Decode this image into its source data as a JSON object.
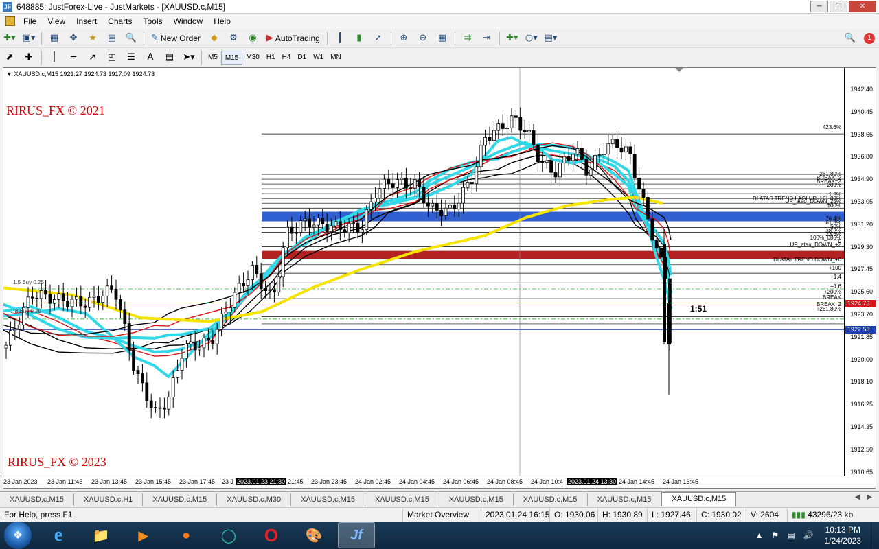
{
  "window": {
    "title": "648885: JustForex-Live - JustMarkets - [XAUUSD.c,M15]",
    "icon_label": "JF"
  },
  "menu": [
    "File",
    "View",
    "Insert",
    "Charts",
    "Tools",
    "Window",
    "Help"
  ],
  "toolbar": {
    "new_order": "New Order",
    "auto_trading": "AutoTrading",
    "timeframes": [
      "M5",
      "M15",
      "M30",
      "H1",
      "H4",
      "D1",
      "W1",
      "MN"
    ],
    "active_timeframe": "M15"
  },
  "chart": {
    "header": "XAUUSD.c,M15  1921.27 1924.73 1917.09 1924.73",
    "watermark_top": "RIRUS_FX © 2021",
    "watermark_bottom": "RIRUS_FX © 2023",
    "countdown": "1:51",
    "price_ticks": [
      "1942.40",
      "1940.45",
      "1938.65",
      "1936.80",
      "1934.90",
      "1933.05",
      "1931.20",
      "1929.30",
      "1927.45",
      "1925.60",
      "1923.70",
      "1921.85",
      "1920.00",
      "1918.10",
      "1916.25",
      "1914.35",
      "1912.50",
      "1910.65"
    ],
    "bid_price": "1924.73",
    "line_price": "1922.53",
    "time_ticks": [
      "23 Jan 2023",
      "23 Jan 11:45",
      "23 Jan 13:45",
      "23 Jan 15:45",
      "23 Jan 17:45",
      "23 J",
      "2023.01.23 21:30",
      "21:45",
      "23 Jan 23:45",
      "24 Jan 02:45",
      "24 Jan 04:45",
      "24 Jan 06:45",
      "24 Jan 08:45",
      "24 Jan 10:4",
      "2023.01.24 13:30",
      "24 Jan 14:45",
      "24 Jan 16:45"
    ],
    "level_labels": [
      "423.6%",
      "261.80%",
      "BREAK_2",
      "BREAK_2",
      "200%",
      "1.8%",
      "DI ATAS TREND LAGI UP_161.80%",
      "UP_atau_DOWN_25%",
      "100%",
      "76.4%",
      "61.8%",
      "50%",
      "38.2%",
      "23.6%",
      "100%_085%",
      "0",
      "UP_atau_DOWN_+2",
      "DI ATAs TREND DOWN_+0",
      "+100",
      "+1.4",
      "+1.6",
      "+200%",
      "BREAK",
      "BREAK_2",
      "+261.80%"
    ],
    "left_labels": [
      "1.5 Buy 0.25",
      "1.8 Buy 0.25"
    ],
    "colors": {
      "blue_zone": "#2f5fd0",
      "red_zone": "#b22222",
      "yellow_ma": "#f5e400",
      "cyan_band": "#31d8e8",
      "red_band": "#e01010"
    }
  },
  "tabs": [
    "XAUUSD.c,M15",
    "XAUUSD.c,H1",
    "XAUUSD.c,M15",
    "XAUUSD.c,M30",
    "XAUUSD.c,M15",
    "XAUUSD.c,M15",
    "XAUUSD.c,M15",
    "XAUUSD.c,M15",
    "XAUUSD.c,M15",
    "XAUUSD.c,M15"
  ],
  "active_tab_index": 9,
  "status": {
    "help": "For Help, press F1",
    "profile": "Market Overview",
    "datetime": "2023.01.24 16:15",
    "open": "O: 1930.06",
    "high": "H: 1930.89",
    "low": "L: 1927.46",
    "close": "C: 1930.02",
    "volume": "V: 2604",
    "traffic": "43296/23 kb"
  },
  "taskbar": {
    "apps": [
      "internet-explorer",
      "file-explorer",
      "media-player",
      "firefox",
      "edge",
      "opera",
      "paint",
      "justforex-mt4"
    ],
    "time": "10:13 PM",
    "date": "1/24/2023"
  }
}
